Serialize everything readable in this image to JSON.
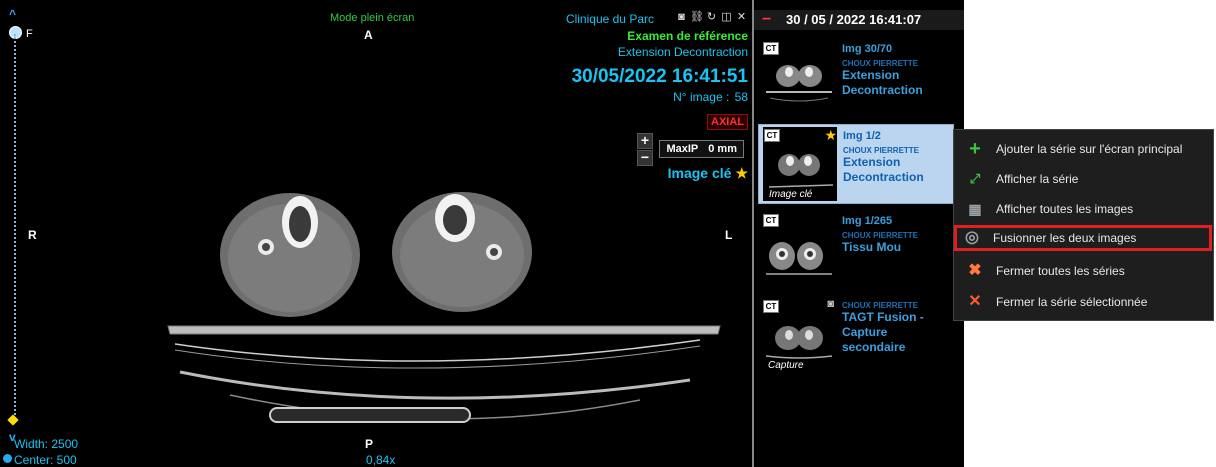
{
  "viewer": {
    "fullscreen_label": "Mode plein écran",
    "orientation": {
      "top": "A",
      "bottom": "P",
      "left": "R",
      "right": "L",
      "slider_top": "F"
    },
    "clinic_name": "Clinique du Parc",
    "reference_exam": "Examen de référence",
    "series_name": "Extension Decontraction",
    "datetime": "30/05/2022 16:41:51",
    "image_number_label": "N° image :",
    "image_number": "58",
    "plane": "AXIAL",
    "projection_mode": "MaxIP",
    "slab_thickness": "0 mm",
    "key_image_label": "Image clé",
    "window_width": "Width: 2500",
    "window_center": "Center: 500",
    "zoom": "0,84x",
    "zoom_in_symbol": "+",
    "zoom_out_symbol": "−",
    "slice_position": 0.0,
    "icons": [
      "camera-icon",
      "link-icon",
      "rotate-icon",
      "window-icon",
      "close-icon"
    ],
    "colors": {
      "accent": "#19c3f2",
      "reference": "#33ee33",
      "alert": "#ff3030",
      "key": "#ffcc00"
    }
  },
  "panel": {
    "header_date": "30 / 05 / 2022 16:41:07",
    "collapse_symbol": "−",
    "series": [
      {
        "modality": "CT",
        "img_count": "Img 30/70",
        "patient": "CHOUX PIERRETTE",
        "description": [
          "Extension",
          "Decontraction"
        ],
        "caption": "",
        "selected": false,
        "key_image": false
      },
      {
        "modality": "CT",
        "img_count": "Img 1/2",
        "patient": "CHOUX PIERRETTE",
        "description": [
          "Extension",
          "Decontraction"
        ],
        "caption": "Image clé",
        "selected": true,
        "key_image": true
      },
      {
        "modality": "CT",
        "img_count": "Img 1/265",
        "patient": "CHOUX PIERRETTE",
        "description": [
          "Tissu Mou"
        ],
        "caption": "",
        "selected": false,
        "key_image": false
      },
      {
        "modality": "CT",
        "img_count": "",
        "patient": "CHOUX PIERRETTE",
        "description": [
          "TAGT Fusion -",
          "Capture",
          "secondaire"
        ],
        "caption": "Capture",
        "selected": false,
        "key_image": false
      }
    ]
  },
  "context_menu": {
    "items": [
      {
        "label": "Ajouter la série sur l'écran principal",
        "icon": "plus-icon",
        "icon_color": "#3cc23c"
      },
      {
        "label": "Afficher la série",
        "icon": "expand-icon",
        "icon_color": "#3cc23c"
      },
      {
        "label": "Afficher toutes les images",
        "icon": "grid-icon",
        "icon_color": "#9aa0a6"
      },
      {
        "label": "Fusionner les deux images",
        "icon": "fusion-icon",
        "icon_color": "#9aa0a6",
        "highlighted": true
      },
      {
        "label": "Fermer toutes les séries",
        "icon": "close-all-icon",
        "icon_color": "#ff7a3c"
      },
      {
        "label": "Fermer la série sélectionnée",
        "icon": "close-icon",
        "icon_color": "#ff5a2a"
      }
    ]
  }
}
